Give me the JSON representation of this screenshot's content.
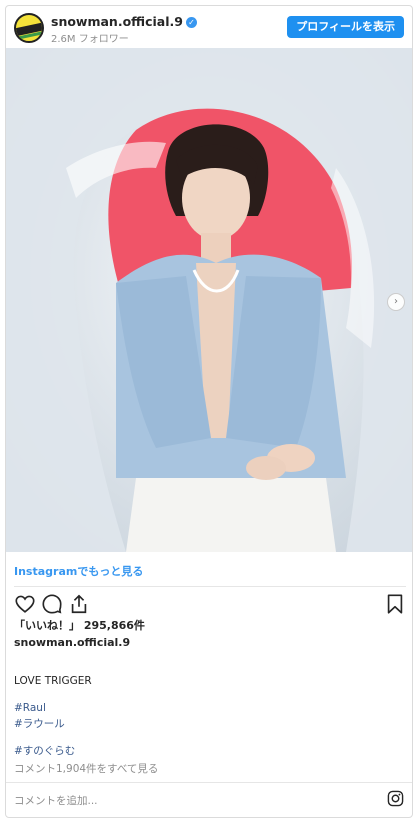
{
  "header": {
    "username": "snowman.official.9",
    "verified_mark": "✓",
    "followers": "2.6M フォロワー",
    "profile_button": "プロフィールを表示"
  },
  "post": {
    "more_link": "Instagramでもっと見る",
    "likes": "「いいね！」 295,866件",
    "caption_user": "snowman.official.9",
    "caption_text": "LOVE TRIGGER",
    "hashtags": [
      "#Raul",
      "#ラウール",
      "#すのぐらむ"
    ],
    "view_comments": "コメント1,904件をすべて見る",
    "add_comment_placeholder": "コメントを追加...",
    "next_arrow": "›"
  },
  "icons": {
    "like": "heart-icon",
    "comment": "comment-icon",
    "share": "share-icon",
    "save": "bookmark-icon",
    "instagram": "instagram-icon",
    "verified": "verified-badge-icon"
  },
  "colors": {
    "accent_blue": "#1e90f0",
    "link_blue": "#3897f0",
    "hashtag": "#3a5a8c",
    "muted": "#8e8e8e"
  }
}
